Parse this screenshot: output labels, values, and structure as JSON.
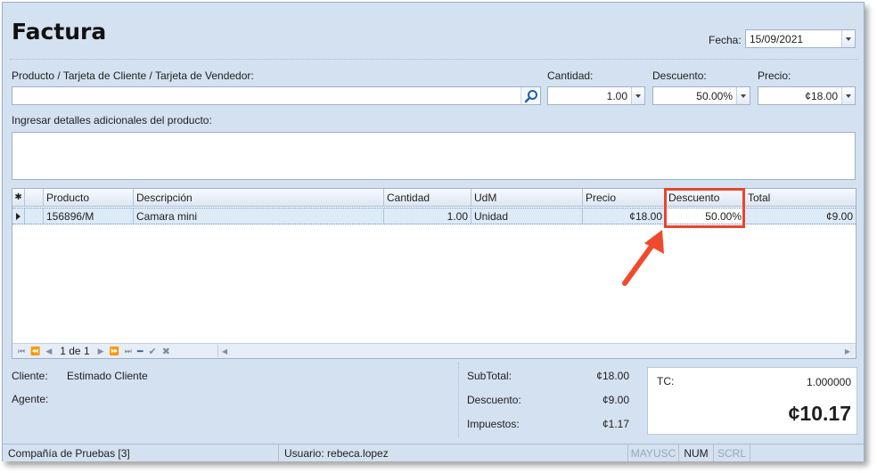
{
  "form": {
    "title": "Factura",
    "fecha_label": "Fecha:",
    "fecha_value": "15/09/2021",
    "producto_label": "Producto / Tarjeta de Cliente / Tarjeta de Vendedor:",
    "producto_value": "",
    "cantidad_label": "Cantidad:",
    "cantidad_value": "1.00",
    "descuento_label": "Descuento:",
    "descuento_value": "50.00%",
    "precio_label": "Precio:",
    "precio_value": "¢18.00",
    "detalles_label": "Ingresar detalles adicionales del producto:",
    "detalles_value": ""
  },
  "grid": {
    "columns": [
      "Producto",
      "Descripción",
      "Cantidad",
      "UdM",
      "Precio",
      "Descuento",
      "Total"
    ],
    "rows": [
      {
        "producto": "156896/M",
        "descripcion": "Camara mini",
        "cantidad": "1.00",
        "udm": "Unidad",
        "precio": "¢18.00",
        "descuento": "50.00%",
        "total": "¢9.00"
      }
    ],
    "pager": "1 de 1"
  },
  "summary": {
    "cliente_label": "Cliente:",
    "cliente_value": "Estimado Cliente",
    "agente_label": "Agente:",
    "subtotal_label": "SubTotal:",
    "subtotal_value": "¢18.00",
    "descuento_label": "Descuento:",
    "descuento_value": "¢9.00",
    "impuestos_label": "Impuestos:",
    "impuestos_value": "¢1.17",
    "tc_label": "TC:",
    "tc_value": "1.000000",
    "total_value": "¢10.17"
  },
  "status": {
    "company": "Compañía de Pruebas [3]",
    "user": "Usuario: rebeca.lopez",
    "mayusc": "MAYUSC",
    "num": "NUM",
    "scrl": "SCRL"
  },
  "colors": {
    "window_bg": "#d4e1f0",
    "highlight": "#e8452d",
    "selected_row": "#ddeaf8"
  }
}
